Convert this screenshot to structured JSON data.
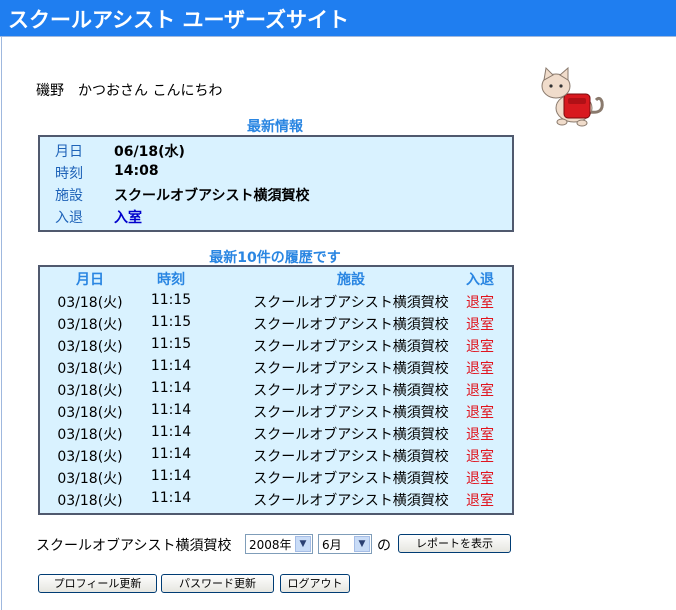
{
  "header": {
    "title": "スクールアシスト ユーザーズサイト"
  },
  "greeting": "磯野　かつおさん こんにちわ",
  "latest": {
    "title": "最新情報",
    "rows": [
      {
        "label": "月日",
        "value": "06/18(水)"
      },
      {
        "label": "時刻",
        "value": "14:08"
      },
      {
        "label": "施設",
        "value": "スクールオブアシスト横須賀校"
      },
      {
        "label": "入退",
        "value": "入室"
      }
    ]
  },
  "history": {
    "title": "最新10件の履歴です",
    "headers": {
      "date": "月日",
      "time": "時刻",
      "facility": "施設",
      "inout": "入退"
    },
    "rows": [
      {
        "date": "03/18(火)",
        "time": "11:15",
        "facility": "スクールオブアシスト横須賀校",
        "inout": "退室"
      },
      {
        "date": "03/18(火)",
        "time": "11:15",
        "facility": "スクールオブアシスト横須賀校",
        "inout": "退室"
      },
      {
        "date": "03/18(火)",
        "time": "11:15",
        "facility": "スクールオブアシスト横須賀校",
        "inout": "退室"
      },
      {
        "date": "03/18(火)",
        "time": "11:14",
        "facility": "スクールオブアシスト横須賀校",
        "inout": "退室"
      },
      {
        "date": "03/18(火)",
        "time": "11:14",
        "facility": "スクールオブアシスト横須賀校",
        "inout": "退室"
      },
      {
        "date": "03/18(火)",
        "time": "11:14",
        "facility": "スクールオブアシスト横須賀校",
        "inout": "退室"
      },
      {
        "date": "03/18(火)",
        "time": "11:14",
        "facility": "スクールオブアシスト横須賀校",
        "inout": "退室"
      },
      {
        "date": "03/18(火)",
        "time": "11:14",
        "facility": "スクールオブアシスト横須賀校",
        "inout": "退室"
      },
      {
        "date": "03/18(火)",
        "time": "11:14",
        "facility": "スクールオブアシスト横須賀校",
        "inout": "退室"
      },
      {
        "date": "03/18(火)",
        "time": "11:14",
        "facility": "スクールオブアシスト横須賀校",
        "inout": "退室"
      }
    ]
  },
  "report": {
    "school_label": "スクールオブアシスト横須賀校",
    "year_value": "2008年",
    "month_value": "6月",
    "particle": "の",
    "show_button": "レポートを表示"
  },
  "actions": {
    "profile_button": "プロフィール更新",
    "password_button": "パスワード更新",
    "logout_button": "ログアウト"
  },
  "icons": {
    "mascot": "cat-with-red-backpack-icon",
    "dropdown": "dropdown-arrow-icon"
  },
  "colors": {
    "header_bg": "#1f7ef0",
    "panel_bg": "#d9f2ff",
    "accent_text": "#2a86e2",
    "exit_red": "#e0141e"
  }
}
